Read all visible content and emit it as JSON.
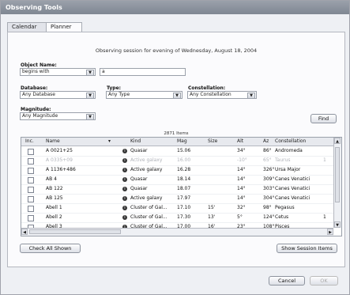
{
  "window": {
    "title": "Observing Tools"
  },
  "tabs": [
    {
      "label": "Calendar",
      "active": false
    },
    {
      "label": "Planner",
      "active": true
    }
  ],
  "session_header": "Observing session for evening of Wednesday, August 18, 2004",
  "filters": {
    "object_name": {
      "label": "Object Name:",
      "match_mode": "begins with",
      "value": "a"
    },
    "database": {
      "label": "Database:",
      "value": "Any Database"
    },
    "type": {
      "label": "Type:",
      "value": "Any Type"
    },
    "constellation": {
      "label": "Constellation:",
      "value": "Any Constellation"
    },
    "magnitude": {
      "label": "Magnitude:",
      "value": "Any Magnitude"
    }
  },
  "buttons": {
    "find": "Find",
    "check_all": "Check All Shown",
    "show_session": "Show Session Items",
    "cancel": "Cancel",
    "ok": "OK"
  },
  "results": {
    "count_label": "2871 Items",
    "columns": [
      "Inc.",
      "Name",
      "",
      "Kind",
      "Mag",
      "Size",
      "Alt",
      "Az",
      "Constellation"
    ],
    "rows": [
      {
        "name": "A 0021+25",
        "kind": "Quasar",
        "mag": "15.06",
        "size": "",
        "alt": "34°",
        "az": "86°",
        "constellation": "Andromeda",
        "dimmed": false,
        "extra": ""
      },
      {
        "name": "A 0335+09",
        "kind": "Active galaxy",
        "mag": "16.00",
        "size": "",
        "alt": "-10°",
        "az": "65°",
        "constellation": "Taurus",
        "dimmed": true,
        "extra": "1"
      },
      {
        "name": "A 1136+486",
        "kind": "Active galaxy",
        "mag": "16.28",
        "size": "",
        "alt": "14°",
        "az": "326°",
        "constellation": "Ursa Major",
        "dimmed": false,
        "extra": ""
      },
      {
        "name": "AB 4",
        "kind": "Quasar",
        "mag": "18.14",
        "size": "",
        "alt": "14°",
        "az": "309°",
        "constellation": "Canes Venatici",
        "dimmed": false,
        "extra": ""
      },
      {
        "name": "AB 122",
        "kind": "Quasar",
        "mag": "18.07",
        "size": "",
        "alt": "14°",
        "az": "303°",
        "constellation": "Canes Venatici",
        "dimmed": false,
        "extra": ""
      },
      {
        "name": "AB 125",
        "kind": "Active galaxy",
        "mag": "17.97",
        "size": "",
        "alt": "14°",
        "az": "304°",
        "constellation": "Canes Venatici",
        "dimmed": false,
        "extra": ""
      },
      {
        "name": "Abell 1",
        "kind": "Cluster of Gal...",
        "mag": "17.10",
        "size": "15'",
        "alt": "32°",
        "az": "98°",
        "constellation": "Pegasus",
        "dimmed": false,
        "extra": ""
      },
      {
        "name": "Abell 2",
        "kind": "Cluster of Gal...",
        "mag": "17.30",
        "size": "13'",
        "alt": "5°",
        "az": "124°",
        "constellation": "Cetus",
        "dimmed": false,
        "extra": "1"
      },
      {
        "name": "Abell 3",
        "kind": "Cluster of Gal...",
        "mag": "17.00",
        "size": "16'",
        "alt": "23°",
        "az": "108°",
        "constellation": "Pisces",
        "dimmed": false,
        "extra": ""
      }
    ]
  },
  "icons": {
    "combo_arrow": "chevron-down-icon",
    "info": "info-icon",
    "sort": "sort-arrow-icon"
  }
}
